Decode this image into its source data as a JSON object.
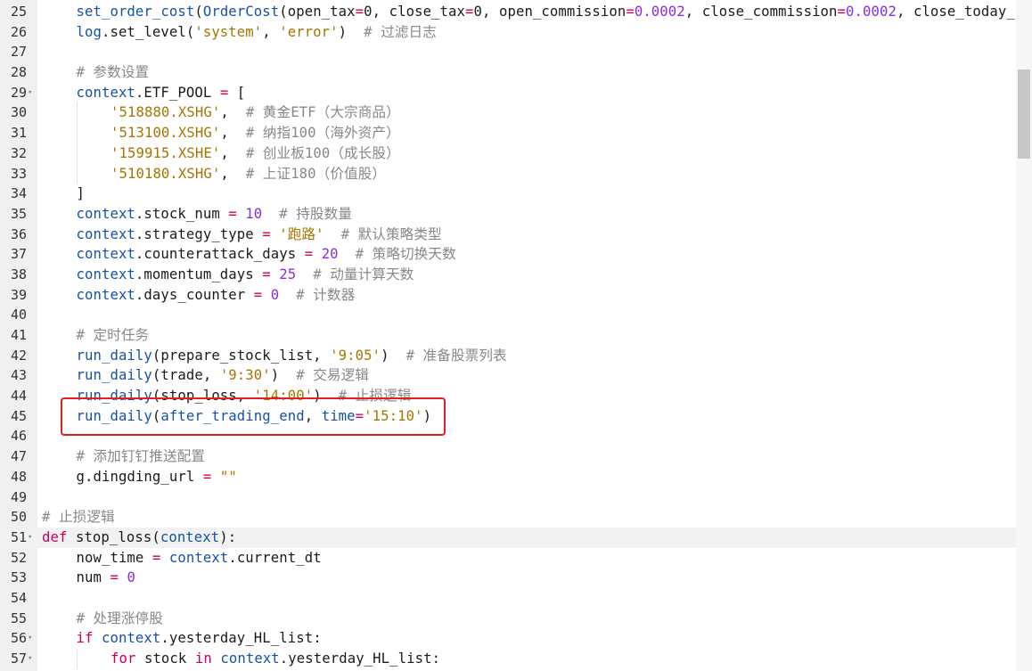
{
  "editor": {
    "lines": [
      {
        "no": "25",
        "fold": false,
        "indent": 1,
        "tokens": [
          [
            "func",
            "set_order_cost"
          ],
          [
            "plain",
            "("
          ],
          [
            "func",
            "OrderCost"
          ],
          [
            "plain",
            "(open_tax"
          ],
          [
            "op",
            "="
          ],
          [
            "plain",
            "0, close_tax"
          ],
          [
            "op",
            "="
          ],
          [
            "plain",
            "0, open_commission"
          ],
          [
            "op",
            "="
          ],
          [
            "num",
            "0.0002"
          ],
          [
            "plain",
            ", close_commission"
          ],
          [
            "op",
            "="
          ],
          [
            "num",
            "0.0002"
          ],
          [
            "plain",
            ", close_today_"
          ]
        ]
      },
      {
        "no": "26",
        "fold": false,
        "indent": 1,
        "tokens": [
          [
            "func",
            "log"
          ],
          [
            "plain",
            ".set_level("
          ],
          [
            "str",
            "'system'"
          ],
          [
            "plain",
            ", "
          ],
          [
            "str",
            "'error'"
          ],
          [
            "plain",
            ")  "
          ],
          [
            "com",
            "# 过滤日志"
          ]
        ]
      },
      {
        "no": "27",
        "fold": false,
        "indent": 0,
        "tokens": []
      },
      {
        "no": "28",
        "fold": false,
        "indent": 1,
        "tokens": [
          [
            "com",
            "# 参数设置"
          ]
        ]
      },
      {
        "no": "29",
        "fold": true,
        "indent": 1,
        "tokens": [
          [
            "ctx",
            "context"
          ],
          [
            "plain",
            ".ETF_POOL "
          ],
          [
            "op",
            "="
          ],
          [
            "plain",
            " ["
          ]
        ]
      },
      {
        "no": "30",
        "fold": false,
        "indent": 2,
        "tokens": [
          [
            "str",
            "'518880.XSHG'"
          ],
          [
            "plain",
            ",  "
          ],
          [
            "com",
            "# 黄金ETF（大宗商品）"
          ]
        ]
      },
      {
        "no": "31",
        "fold": false,
        "indent": 2,
        "tokens": [
          [
            "str",
            "'513100.XSHG'"
          ],
          [
            "plain",
            ",  "
          ],
          [
            "com",
            "# 纳指100（海外资产）"
          ]
        ]
      },
      {
        "no": "32",
        "fold": false,
        "indent": 2,
        "tokens": [
          [
            "str",
            "'159915.XSHE'"
          ],
          [
            "plain",
            ",  "
          ],
          [
            "com",
            "# 创业板100（成长股）"
          ]
        ]
      },
      {
        "no": "33",
        "fold": false,
        "indent": 2,
        "tokens": [
          [
            "str",
            "'510180.XSHG'"
          ],
          [
            "plain",
            ",  "
          ],
          [
            "com",
            "# 上证180（价值股）"
          ]
        ]
      },
      {
        "no": "34",
        "fold": false,
        "indent": 1,
        "tokens": [
          [
            "plain",
            "]"
          ]
        ]
      },
      {
        "no": "35",
        "fold": false,
        "indent": 1,
        "tokens": [
          [
            "ctx",
            "context"
          ],
          [
            "plain",
            ".stock_num "
          ],
          [
            "op",
            "="
          ],
          [
            "plain",
            " "
          ],
          [
            "num",
            "10"
          ],
          [
            "plain",
            "  "
          ],
          [
            "com",
            "# 持股数量"
          ]
        ]
      },
      {
        "no": "36",
        "fold": false,
        "indent": 1,
        "tokens": [
          [
            "ctx",
            "context"
          ],
          [
            "plain",
            ".strategy_type "
          ],
          [
            "op",
            "="
          ],
          [
            "plain",
            " "
          ],
          [
            "str",
            "'跑路'"
          ],
          [
            "plain",
            "  "
          ],
          [
            "com",
            "# 默认策略类型"
          ]
        ]
      },
      {
        "no": "37",
        "fold": false,
        "indent": 1,
        "tokens": [
          [
            "ctx",
            "context"
          ],
          [
            "plain",
            ".counterattack_days "
          ],
          [
            "op",
            "="
          ],
          [
            "plain",
            " "
          ],
          [
            "num",
            "20"
          ],
          [
            "plain",
            "  "
          ],
          [
            "com",
            "# 策略切换天数"
          ]
        ]
      },
      {
        "no": "38",
        "fold": false,
        "indent": 1,
        "tokens": [
          [
            "ctx",
            "context"
          ],
          [
            "plain",
            ".momentum_days "
          ],
          [
            "op",
            "="
          ],
          [
            "plain",
            " "
          ],
          [
            "num",
            "25"
          ],
          [
            "plain",
            "  "
          ],
          [
            "com",
            "# 动量计算天数"
          ]
        ]
      },
      {
        "no": "39",
        "fold": false,
        "indent": 1,
        "tokens": [
          [
            "ctx",
            "context"
          ],
          [
            "plain",
            ".days_counter "
          ],
          [
            "op",
            "="
          ],
          [
            "plain",
            " "
          ],
          [
            "num",
            "0"
          ],
          [
            "plain",
            "  "
          ],
          [
            "com",
            "# 计数器"
          ]
        ]
      },
      {
        "no": "40",
        "fold": false,
        "indent": 0,
        "tokens": []
      },
      {
        "no": "41",
        "fold": false,
        "indent": 1,
        "tokens": [
          [
            "com",
            "# 定时任务"
          ]
        ]
      },
      {
        "no": "42",
        "fold": false,
        "indent": 1,
        "tokens": [
          [
            "func",
            "run_daily"
          ],
          [
            "plain",
            "(prepare_stock_list, "
          ],
          [
            "str",
            "'9:05'"
          ],
          [
            "plain",
            ")  "
          ],
          [
            "com",
            "# 准备股票列表"
          ]
        ]
      },
      {
        "no": "43",
        "fold": false,
        "indent": 1,
        "tokens": [
          [
            "func",
            "run_daily"
          ],
          [
            "plain",
            "(trade, "
          ],
          [
            "str",
            "'9:30'"
          ],
          [
            "plain",
            ")  "
          ],
          [
            "com",
            "# 交易逻辑"
          ]
        ]
      },
      {
        "no": "44",
        "fold": false,
        "indent": 1,
        "tokens": [
          [
            "func",
            "run_daily"
          ],
          [
            "plain",
            "(stop_loss, "
          ],
          [
            "str",
            "'14:00'"
          ],
          [
            "plain",
            ")  "
          ],
          [
            "com",
            "# 止损逻辑"
          ]
        ]
      },
      {
        "no": "45",
        "fold": false,
        "indent": 1,
        "tokens": [
          [
            "func",
            "run_daily"
          ],
          [
            "plain",
            "("
          ],
          [
            "func",
            "after_trading_end"
          ],
          [
            "plain",
            ", "
          ],
          [
            "ctx",
            "time"
          ],
          [
            "op",
            "="
          ],
          [
            "str",
            "'15:10'"
          ],
          [
            "plain",
            ")"
          ]
        ]
      },
      {
        "no": "46",
        "fold": false,
        "indent": 0,
        "tokens": []
      },
      {
        "no": "47",
        "fold": false,
        "indent": 1,
        "tokens": [
          [
            "com",
            "# 添加钉钉推送配置"
          ]
        ]
      },
      {
        "no": "48",
        "fold": false,
        "indent": 1,
        "tokens": [
          [
            "plain",
            "g.dingding_url "
          ],
          [
            "op",
            "="
          ],
          [
            "plain",
            " "
          ],
          [
            "str",
            "\"\""
          ]
        ]
      },
      {
        "no": "49",
        "fold": false,
        "indent": 0,
        "tokens": []
      },
      {
        "no": "50",
        "fold": false,
        "indent": 0,
        "tokens": [
          [
            "com",
            "# 止损逻辑"
          ]
        ]
      },
      {
        "no": "51",
        "fold": true,
        "indent": 0,
        "current": true,
        "tokens": [
          [
            "kw",
            "def"
          ],
          [
            "plain",
            " stop_loss("
          ],
          [
            "ctx",
            "context"
          ],
          [
            "plain",
            "):"
          ]
        ]
      },
      {
        "no": "52",
        "fold": false,
        "indent": 1,
        "tokens": [
          [
            "plain",
            "now_time "
          ],
          [
            "op",
            "="
          ],
          [
            "plain",
            " "
          ],
          [
            "ctx",
            "context"
          ],
          [
            "plain",
            ".current_dt"
          ]
        ]
      },
      {
        "no": "53",
        "fold": false,
        "indent": 1,
        "tokens": [
          [
            "plain",
            "num "
          ],
          [
            "op",
            "="
          ],
          [
            "plain",
            " "
          ],
          [
            "num",
            "0"
          ]
        ]
      },
      {
        "no": "54",
        "fold": false,
        "indent": 0,
        "tokens": []
      },
      {
        "no": "55",
        "fold": false,
        "indent": 1,
        "tokens": [
          [
            "com",
            "# 处理涨停股"
          ]
        ]
      },
      {
        "no": "56",
        "fold": true,
        "indent": 1,
        "tokens": [
          [
            "kw",
            "if"
          ],
          [
            "plain",
            " "
          ],
          [
            "ctx",
            "context"
          ],
          [
            "plain",
            ".yesterday_HL_list:"
          ]
        ]
      },
      {
        "no": "57",
        "fold": true,
        "indent": 2,
        "tokens": [
          [
            "kw",
            "for"
          ],
          [
            "plain",
            " stock "
          ],
          [
            "kw",
            "in"
          ],
          [
            "plain",
            " "
          ],
          [
            "ctx",
            "context"
          ],
          [
            "plain",
            ".yesterday_HL_list:"
          ]
        ]
      }
    ]
  }
}
